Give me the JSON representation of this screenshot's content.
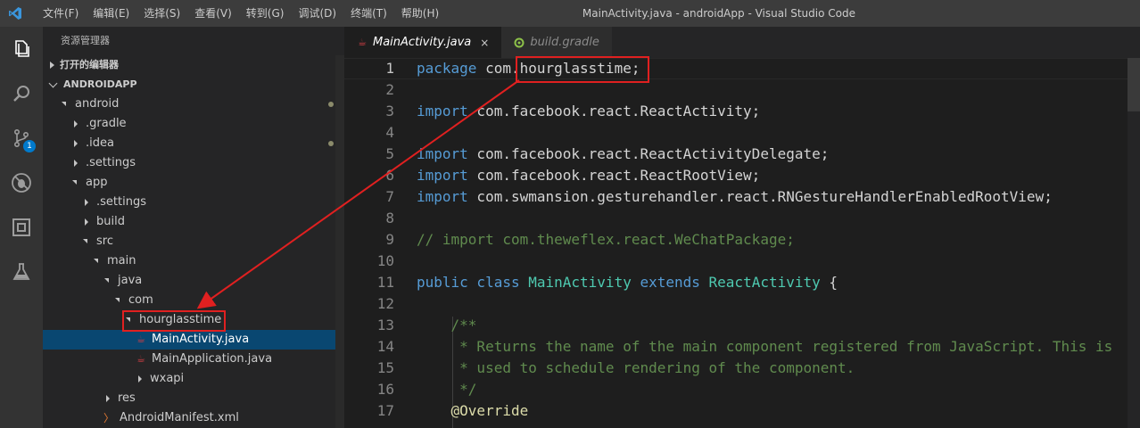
{
  "titlebar": {
    "menu": [
      "文件(F)",
      "编辑(E)",
      "选择(S)",
      "查看(V)",
      "转到(G)",
      "调试(D)",
      "终端(T)",
      "帮助(H)"
    ],
    "window_title": "MainActivity.java - androidApp - Visual Studio Code"
  },
  "activity_bar": {
    "icons": [
      "files-icon",
      "search-icon",
      "source-control-icon",
      "debug-icon",
      "extensions-icon",
      "test-icon"
    ],
    "source_control_badge": "1"
  },
  "sidebar": {
    "title": "资源管理器",
    "open_editors": "打开的编辑器",
    "workspace": "ANDROIDAPP",
    "tree": [
      {
        "label": "android",
        "depth": 0,
        "expanded": true,
        "modified": true
      },
      {
        "label": ".gradle",
        "depth": 1,
        "expanded": false
      },
      {
        "label": ".idea",
        "depth": 1,
        "expanded": false,
        "modified": true
      },
      {
        "label": ".settings",
        "depth": 1,
        "expanded": false
      },
      {
        "label": "app",
        "depth": 1,
        "expanded": true
      },
      {
        "label": ".settings",
        "depth": 2,
        "expanded": false
      },
      {
        "label": "build",
        "depth": 2,
        "expanded": false
      },
      {
        "label": "src",
        "depth": 2,
        "expanded": true
      },
      {
        "label": "main",
        "depth": 3,
        "expanded": true
      },
      {
        "label": "java",
        "depth": 4,
        "expanded": true
      },
      {
        "label": "com",
        "depth": 5,
        "expanded": true
      },
      {
        "label": "hourglasstime",
        "depth": 6,
        "expanded": true
      },
      {
        "label": "MainActivity.java",
        "depth": 7,
        "file": "java",
        "selected": true
      },
      {
        "label": "MainApplication.java",
        "depth": 7,
        "file": "java"
      },
      {
        "label": "wxapi",
        "depth": 7,
        "expanded": false
      },
      {
        "label": "res",
        "depth": 4,
        "expanded": false
      },
      {
        "label": "AndroidManifest.xml",
        "depth": 4,
        "file": "xml"
      }
    ]
  },
  "tabs": [
    {
      "label": "MainActivity.java",
      "active": true,
      "close": "×"
    },
    {
      "label": "build.gradle",
      "active": false
    }
  ],
  "editor": {
    "lines": [
      {
        "n": "1",
        "tokens": [
          [
            "kw",
            "package"
          ],
          [
            "pl",
            " com.hourglasstime;"
          ]
        ]
      },
      {
        "n": "2",
        "tokens": []
      },
      {
        "n": "3",
        "tokens": [
          [
            "kw",
            "import"
          ],
          [
            "pl",
            " com.facebook.react.ReactActivity;"
          ]
        ]
      },
      {
        "n": "4",
        "tokens": []
      },
      {
        "n": "5",
        "tokens": [
          [
            "kw",
            "import"
          ],
          [
            "pl",
            " com.facebook.react.ReactActivityDelegate;"
          ]
        ]
      },
      {
        "n": "6",
        "tokens": [
          [
            "kw",
            "import"
          ],
          [
            "pl",
            " com.facebook.react.ReactRootView;"
          ]
        ]
      },
      {
        "n": "7",
        "tokens": [
          [
            "kw",
            "import"
          ],
          [
            "pl",
            " com.swmansion.gesturehandler.react.RNGestureHandlerEnabledRootView;"
          ]
        ]
      },
      {
        "n": "8",
        "tokens": []
      },
      {
        "n": "9",
        "tokens": [
          [
            "cm",
            "// import com.theweflex.react.WeChatPackage;"
          ]
        ]
      },
      {
        "n": "10",
        "tokens": []
      },
      {
        "n": "11",
        "tokens": [
          [
            "kw",
            "public class "
          ],
          [
            "cls",
            "MainActivity"
          ],
          [
            "kw",
            " extends "
          ],
          [
            "cls",
            "ReactActivity"
          ],
          [
            "pl",
            " {"
          ]
        ]
      },
      {
        "n": "12",
        "tokens": []
      },
      {
        "n": "13",
        "tokens": [
          [
            "cm",
            "    /**"
          ]
        ]
      },
      {
        "n": "14",
        "tokens": [
          [
            "cm",
            "     * Returns the name of the main component registered from JavaScript. This is"
          ]
        ]
      },
      {
        "n": "15",
        "tokens": [
          [
            "cm",
            "     * used to schedule rendering of the component."
          ]
        ]
      },
      {
        "n": "16",
        "tokens": [
          [
            "cm",
            "     */"
          ]
        ]
      },
      {
        "n": "17",
        "tokens": [
          [
            "ann",
            "    @Override"
          ]
        ]
      }
    ]
  },
  "colors": {
    "annotation": "#e02020",
    "selected_row": "#094771",
    "accent": "#007acc"
  }
}
